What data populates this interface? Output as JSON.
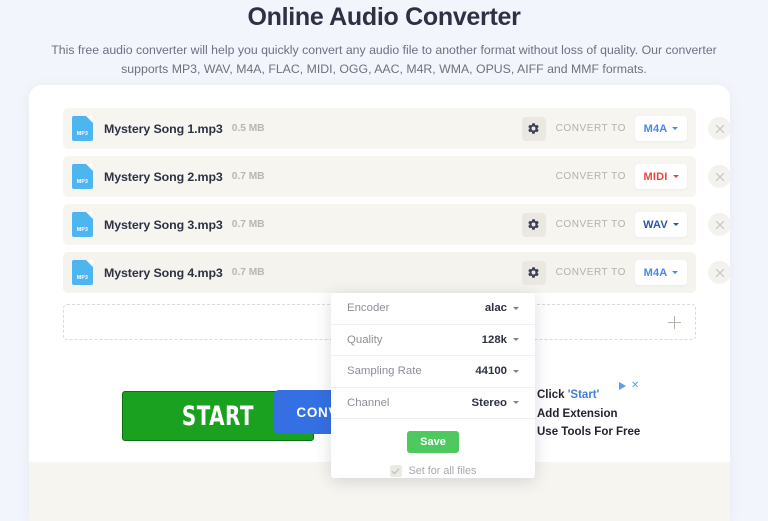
{
  "header": {
    "title": "Online Audio Converter",
    "subtitle": "This free audio converter will help you quickly convert any audio file to another format without loss of quality. Our converter supports MP3, WAV, M4A, FLAC, MIDI, OGG, AAC, M4R, WMA, OPUS, AIFF and MMF formats."
  },
  "files": [
    {
      "icon_label": "MP3",
      "name": "Mystery Song 1.mp3",
      "size": "0.5 MB",
      "convert_to_label": "CONVERT TO",
      "format": "M4A",
      "format_color": "#4a86f0",
      "has_settings": true
    },
    {
      "icon_label": "MP3",
      "name": "Mystery Song 2.mp3",
      "size": "0.7 MB",
      "convert_to_label": "CONVERT TO",
      "format": "MIDI",
      "format_color": "#e8453c",
      "has_settings": false
    },
    {
      "icon_label": "MP3",
      "name": "Mystery Song 3.mp3",
      "size": "0.7 MB",
      "convert_to_label": "CONVERT TO",
      "format": "WAV",
      "format_color": "#2b56a8",
      "has_settings": true
    },
    {
      "icon_label": "MP3",
      "name": "Mystery Song 4.mp3",
      "size": "0.7 MB",
      "convert_to_label": "CONVERT TO",
      "format": "M4A",
      "format_color": "#4a86f0",
      "has_settings": true
    }
  ],
  "add_files": {
    "plus_label": "+"
  },
  "settings_popup": {
    "rows": [
      {
        "label": "Encoder",
        "value": "alac"
      },
      {
        "label": "Quality",
        "value": "128k"
      },
      {
        "label": "Sampling Rate",
        "value": "44100"
      },
      {
        "label": "Channel",
        "value": "Stereo"
      }
    ],
    "save_label": "Save",
    "set_for_all_label": "Set for all files",
    "set_for_all_checked": true
  },
  "ad": {
    "start_button_label": "START",
    "lines": [
      {
        "prefix": "Click ",
        "accent": "'Start'",
        "suffix": ""
      },
      {
        "prefix": "Add Extension",
        "accent": "",
        "suffix": ""
      },
      {
        "prefix": "Use Tools For Free",
        "accent": "",
        "suffix": ""
      }
    ],
    "close_label": "✕"
  },
  "footer": {
    "convert_all_label": "CONVERT ALL"
  },
  "colors": {
    "page_bg": "#f2f5fb",
    "card_bg": "#ffffff",
    "row_bg": "#f7f5f0",
    "primary_blue": "#3470e4",
    "ad_green": "#19a11f",
    "save_green": "#4ec95f"
  }
}
